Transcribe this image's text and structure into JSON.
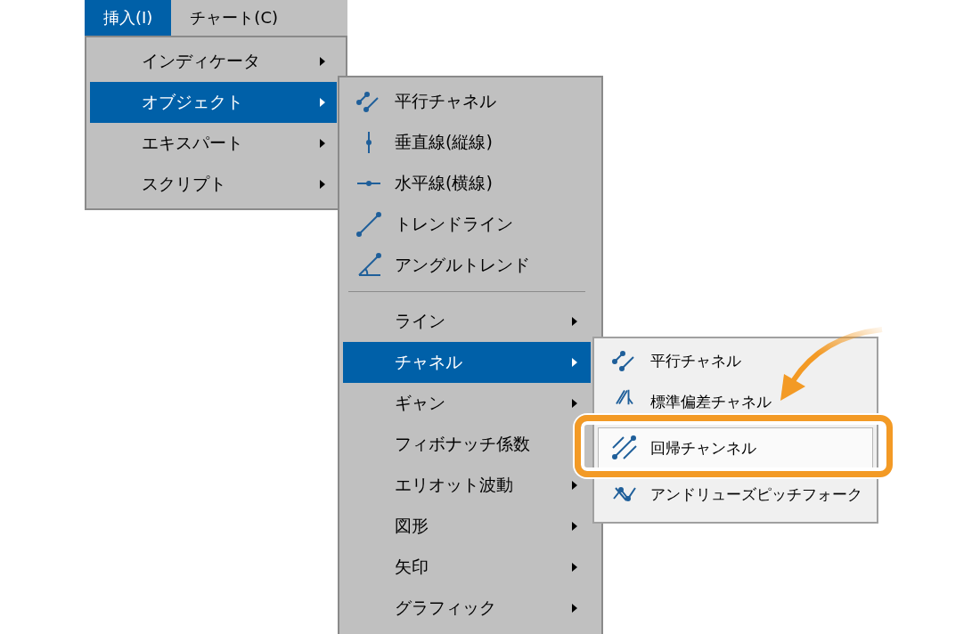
{
  "menu_bar": [
    {
      "label": "挿入(I)",
      "selected": true
    },
    {
      "label": "チャート(C)",
      "selected": false
    }
  ],
  "insert_menu": [
    {
      "label": "インディケータ",
      "selected": false,
      "has_submenu": true
    },
    {
      "label": "オブジェクト",
      "selected": true,
      "has_submenu": true
    },
    {
      "label": "エキスパート",
      "selected": false,
      "has_submenu": true
    },
    {
      "label": "スクリプト",
      "selected": false,
      "has_submenu": true
    }
  ],
  "objects_menu": {
    "recent": [
      {
        "label": "平行チャネル"
      },
      {
        "label": "垂直線(縦線)"
      },
      {
        "label": "水平線(横線)"
      },
      {
        "label": "トレンドライン"
      },
      {
        "label": "アングルトレンド"
      }
    ],
    "categories": [
      {
        "label": "ライン",
        "selected": false,
        "has_submenu": true
      },
      {
        "label": "チャネル",
        "selected": true,
        "has_submenu": true
      },
      {
        "label": "ギャン",
        "selected": false,
        "has_submenu": true
      },
      {
        "label": "フィボナッチ係数",
        "selected": false,
        "has_submenu": false
      },
      {
        "label": "エリオット波動",
        "selected": false,
        "has_submenu": true
      },
      {
        "label": "図形",
        "selected": false,
        "has_submenu": true
      },
      {
        "label": "矢印",
        "selected": false,
        "has_submenu": true
      },
      {
        "label": "グラフィック",
        "selected": false,
        "has_submenu": true
      }
    ]
  },
  "channel_menu": [
    {
      "label": "平行チャネル",
      "selected": false
    },
    {
      "label": "標準偏差チャネル",
      "selected": false
    },
    {
      "label": "回帰チャンネル",
      "selected": true
    },
    {
      "label": "アンドリューズピッチフォーク",
      "selected": false
    }
  ]
}
